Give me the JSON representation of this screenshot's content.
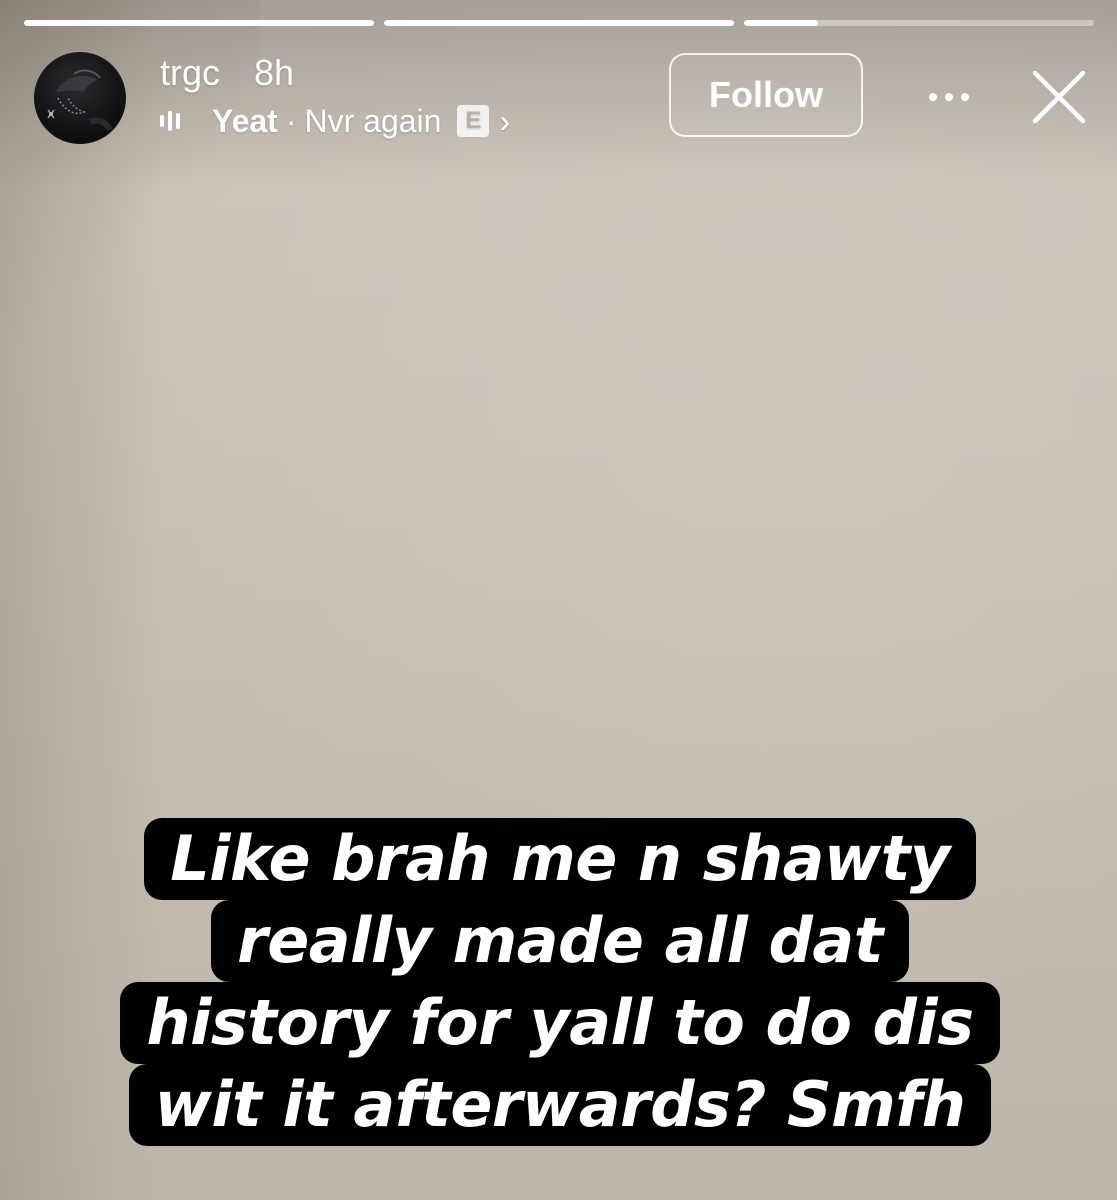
{
  "progress": [
    {
      "fill_percent": 100
    },
    {
      "fill_percent": 100
    },
    {
      "fill_percent": 21
    }
  ],
  "header": {
    "username": "trgc",
    "time_ago": "8h",
    "music": {
      "artist": "Yeat",
      "separator": "·",
      "track": "Nvr again",
      "explicit_badge": "E",
      "chevron": "›"
    },
    "follow_label": "Follow",
    "more_icon": "more-horizontal-icon",
    "close_icon": "close-icon"
  },
  "caption": {
    "lines": [
      "Like brah me n shawty",
      "really made all dat",
      "history for yall to do dis",
      "wit it afterwards? Smfh"
    ]
  },
  "colors": {
    "background": "#c9c1b7",
    "caption_background": "#000000",
    "text": "#ffffff"
  }
}
